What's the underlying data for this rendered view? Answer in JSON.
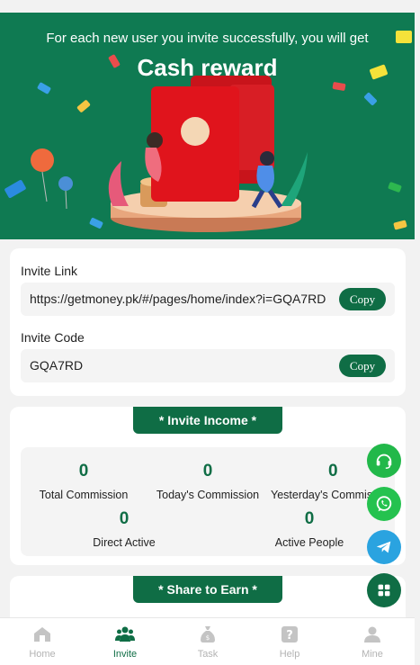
{
  "banner": {
    "subtitle": "For each new user you invite successfully, you will get",
    "title": "Cash reward"
  },
  "invite": {
    "link_label": "Invite Link",
    "link_value": "https://getmoney.pk/#/pages/home/index?i=GQA7RD",
    "code_label": "Invite Code",
    "code_value": "GQA7RD",
    "copy_label": "Copy"
  },
  "income": {
    "title": "* Invite Income *",
    "stats": [
      {
        "value": "0",
        "label": "Total Commission"
      },
      {
        "value": "0",
        "label": "Today's Commission"
      },
      {
        "value": "0",
        "label": "Yesterday's Commission"
      },
      {
        "value": "0",
        "label": "Direct Active"
      },
      {
        "value": "0",
        "label": "Active People"
      }
    ]
  },
  "share": {
    "title": "* Share to Earn *"
  },
  "floating": {
    "support_icon": "headset-icon",
    "whatsapp_icon": "whatsapp-icon",
    "telegram_icon": "telegram-icon",
    "menu_icon": "grid-icon"
  },
  "tabbar": {
    "items": [
      {
        "label": "Home",
        "icon": "home-icon"
      },
      {
        "label": "Invite",
        "icon": "people-icon"
      },
      {
        "label": "Task",
        "icon": "money-bag-icon"
      },
      {
        "label": "Help",
        "icon": "help-icon"
      },
      {
        "label": "Mine",
        "icon": "user-icon"
      }
    ],
    "active_index": 1
  },
  "colors": {
    "brand_green": "#0f6d45",
    "banner_green": "#0f7a52",
    "whatsapp": "#25d366",
    "telegram": "#2aa3e0",
    "inactive": "#b3b3b3"
  }
}
